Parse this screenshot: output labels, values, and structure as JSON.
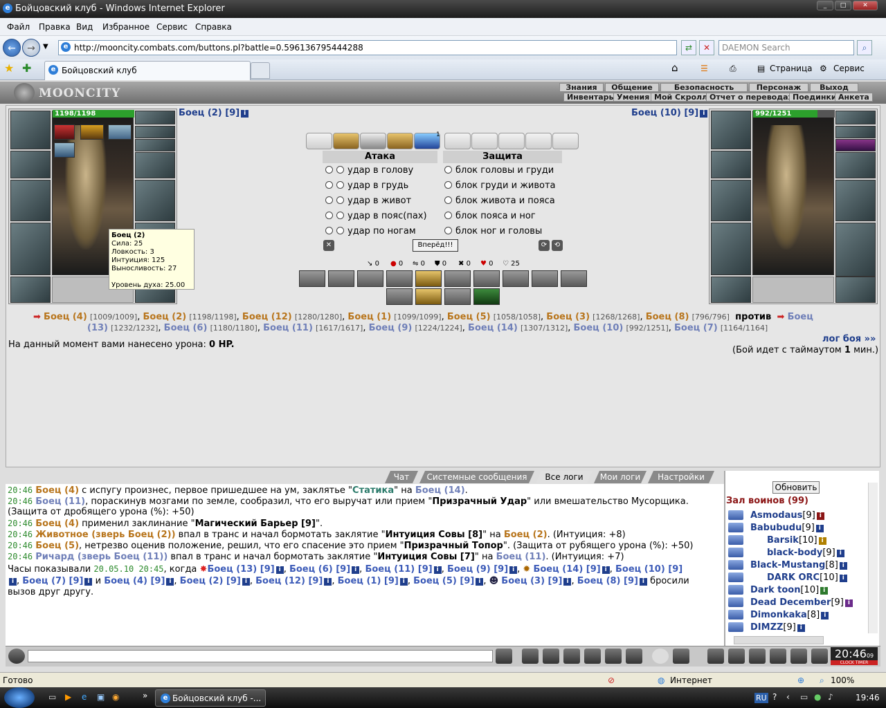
{
  "window": {
    "title": "Бойцовский клуб - Windows Internet Explorer"
  },
  "menu": [
    "Файл",
    "Правка",
    "Вид",
    "Избранное",
    "Сервис",
    "Справка"
  ],
  "address": {
    "url": "http://mooncity.combats.com/buttons.pl?battle=0.596136795444288",
    "search_placeholder": "DAEMON Search"
  },
  "tab": {
    "title": "Бойцовский клуб"
  },
  "toolbar": {
    "page": "Страница",
    "service": "Сервис"
  },
  "game": {
    "logo": "MOONCITY",
    "menu_top": [
      "Знания",
      "Общение",
      "Безопасность",
      "Персонаж",
      "Выход"
    ],
    "menu_bottom": [
      "Инвентарь",
      "Умения",
      "Мой Скролл",
      "Отчет о переводах",
      "Поединки",
      "Анкета"
    ],
    "left": {
      "name": "Боец (2) [9]",
      "hp": "1198/1198"
    },
    "right": {
      "name": "Боец (10) [9]",
      "hp": "992/1251",
      "hp_fraction": 0.79
    },
    "tooltip": {
      "title": "Боец (2)",
      "lines": [
        "Сила: 25",
        "Ловкость: 3",
        "Интуиция: 125",
        "Выносливость: 27"
      ],
      "spirit": "Уровень духа: 25.00"
    },
    "attack": {
      "header": "Атака",
      "options": [
        "удар в голову",
        "удар в грудь",
        "удар в живот",
        "удар в пояс(пах)",
        "удар по ногам"
      ]
    },
    "defense": {
      "header": "Защита",
      "options": [
        "блок головы и груди",
        "блок груди и живота",
        "блок живота и пояса",
        "блок пояса и ног",
        "блок ног и головы"
      ]
    },
    "forward": "Вперёд!!!",
    "stats": [
      "0",
      "0",
      "0",
      "0",
      "0",
      "0",
      "25"
    ],
    "scroll_counter": "1",
    "versus": "против",
    "team1": [
      {
        "n": "Боец (4)",
        "h": "[1009/1009]"
      },
      {
        "n": "Боец (2)",
        "h": "[1198/1198]"
      },
      {
        "n": "Боец (12)",
        "h": "[1280/1280]"
      },
      {
        "n": "Боец (1)",
        "h": "[1099/1099]"
      },
      {
        "n": "Боец (5)",
        "h": "[1058/1058]"
      },
      {
        "n": "Боец (3)",
        "h": "[1268/1268]"
      },
      {
        "n": "Боец (8)",
        "h": "[796/796]"
      }
    ],
    "team2_first": "Боец",
    "team2": [
      {
        "n": "(13)",
        "h": "[1232/1232]"
      },
      {
        "n": "Боец (6)",
        "h": "[1180/1180]"
      },
      {
        "n": "Боец (11)",
        "h": "[1617/1617]"
      },
      {
        "n": "Боец (9)",
        "h": "[1224/1224]"
      },
      {
        "n": "Боец (14)",
        "h": "[1307/1312]"
      },
      {
        "n": "Боец (10)",
        "h": "[992/1251]"
      },
      {
        "n": "Боец (7)",
        "h": "[1164/1164]"
      }
    ],
    "damage_prefix": "На данный момент вами нанесено урона:",
    "damage_value": "0 HP.",
    "log_link": "лог боя »»",
    "timeout_prefix": "(Бой идет с таймаутом",
    "timeout_value": "1",
    "timeout_suffix": "мин.)"
  },
  "log_tabs": [
    "Чат",
    "Системные сообщения",
    "Все логи",
    "Мои логи",
    "Настройки"
  ],
  "log": {
    "l1": {
      "t": "20:46",
      "a": "Боец (4)",
      "b": " с испугу произнес, первое пришедшее на ум, заклятье \"",
      "s": "Статика",
      "c": "\" на ",
      "d": "Боец (14)",
      "e": "."
    },
    "l2": {
      "t": "20:46",
      "a": "Боец (11)",
      "b": ", пораскинув мозгами по земле, сообразил, что его выручат или прием \"",
      "s": "Призрачный Удар",
      "c": "\" или вмешательство Мусорщика."
    },
    "l3": "(Защита от дробящего урона (%): +50)",
    "l4": {
      "t": "20:46",
      "a": "Боец (4)",
      "b": " применил заклинание \"",
      "s": "Магический Барьер [9]",
      "c": "\"."
    },
    "l5": {
      "t": "20:46",
      "a": "Животное (зверь Боец (2))",
      "b": " впал в транс и начал бормотать заклятие \"",
      "s": "Интуиция Совы [8]",
      "c": "\" на ",
      "d": "Боец (2)",
      "e": ". (Интуиция: +8)"
    },
    "l6": {
      "t": "20:46",
      "a": "Боец (5)",
      "b": ", нетрезво оценив положение, решил, что его спасение это прием \"",
      "s": "Призрачный Топор",
      "c": "\". (Защита от рубящего урона (%): +50)"
    },
    "l7": {
      "t": "20:46",
      "a": "Ричард (зверь Боец (11))",
      "b": " впал в транс и начал бормотать заклятие \"",
      "s": "Интуиция Совы [7]",
      "c": "\" на ",
      "d": "Боец (11)",
      "e": ". (Интуиция: +7)"
    },
    "l8": {
      "a": "Часы показывали ",
      "t": "20.05.10 20:45",
      "b": ", когда ",
      "n1": "Боец (13) [9]",
      "n2": "Боец (6) [9]",
      "n3": "Боец (11) [9]",
      "n4": "Боец (9) [9]",
      "n5": "Боец (14) [9]",
      "n6": "Боец (10) [9]"
    },
    "l9": {
      "n1": "Боец (7) [9]",
      "and": " и ",
      "n2": "Боец (4) [9]",
      "n3": "Боец (2) [9]",
      "n4": "Боец (12) [9]",
      "n5": "Боец (1) [9]",
      "n6": "Боец (5) [9]",
      "n7": "Боец (3) [9]",
      "n8": "Боец (8) [9]",
      "end": " бросили"
    },
    "l10": "вызов друг другу."
  },
  "side": {
    "refresh": "Обновить",
    "hall": "Зал воинов (99)",
    "users": [
      {
        "n": "Asmodaus",
        "l": "[9]"
      },
      {
        "n": "Babubudu",
        "l": "[9]"
      },
      {
        "n": "Barsik",
        "l": "[10]"
      },
      {
        "n": "black-body",
        "l": "[9]"
      },
      {
        "n": "Black-Mustang",
        "l": "[8]"
      },
      {
        "n": "DARK ORC",
        "l": "[10]"
      },
      {
        "n": "Dark toon",
        "l": "[10]"
      },
      {
        "n": "Dead December",
        "l": "[9]"
      },
      {
        "n": "Dimonkaka",
        "l": "[8]"
      },
      {
        "n": "DIMZZ",
        "l": "[9]"
      }
    ]
  },
  "clock": {
    "time": "20:46",
    "sec": "09",
    "label": "CLOCK TIMER"
  },
  "status": {
    "text": "Готово",
    "zone": "Интернет",
    "zoom": "100%"
  },
  "taskbar": {
    "task": "Бойцовский клуб -...",
    "lang": "RU",
    "time": "19:46"
  }
}
